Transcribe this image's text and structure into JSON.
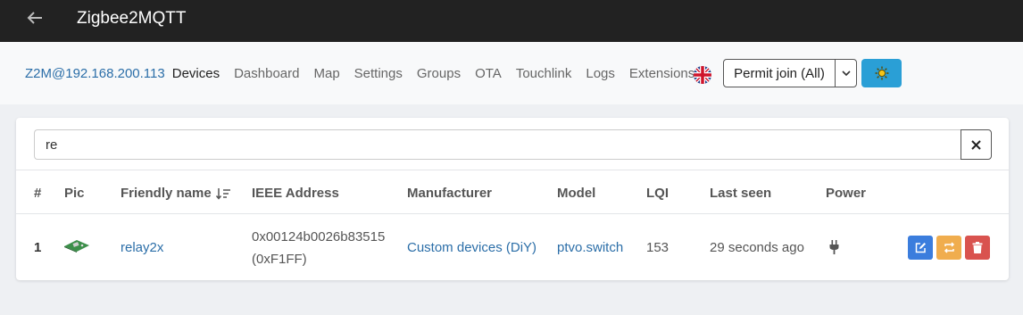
{
  "app": {
    "title": "Zigbee2MQTT"
  },
  "nav": {
    "brand": "Z2M@192.168.200.113",
    "items": [
      "Devices",
      "Dashboard",
      "Map",
      "Settings",
      "Groups",
      "OTA",
      "Touchlink",
      "Logs",
      "Extensions"
    ],
    "active": "Devices"
  },
  "toolbar": {
    "language_icon": "uk-flag-icon",
    "permit_join_label": "Permit join (All)",
    "theme_icon": "sun-icon",
    "theme_button_color": "#2a9fd6"
  },
  "search": {
    "value": "re",
    "clear_icon": "close-icon"
  },
  "table": {
    "columns": [
      "#",
      "Pic",
      "Friendly name",
      "IEEE Address",
      "Manufacturer",
      "Model",
      "LQI",
      "Last seen",
      "Power"
    ],
    "sort_icon": "sort-alpha-down-icon",
    "rows": [
      {
        "index": "1",
        "pic_icon": "relay-board-icon",
        "friendly_name": "relay2x",
        "ieee_address": "0x00124b0026b83515",
        "network_address": "(0xF1FF)",
        "manufacturer": "Custom devices (DiY)",
        "model": "ptvo.switch",
        "lqi": "153",
        "last_seen": "29 seconds ago",
        "power_icon": "plug-icon"
      }
    ],
    "actions": [
      {
        "icon": "edit-icon",
        "color": "#3b7ddd"
      },
      {
        "icon": "refresh-icon",
        "color": "#f0ad4e"
      },
      {
        "icon": "trash-icon",
        "color": "#d9534f"
      }
    ]
  },
  "colors": {
    "link": "#2b6ea8",
    "titlebar": "#222222"
  }
}
